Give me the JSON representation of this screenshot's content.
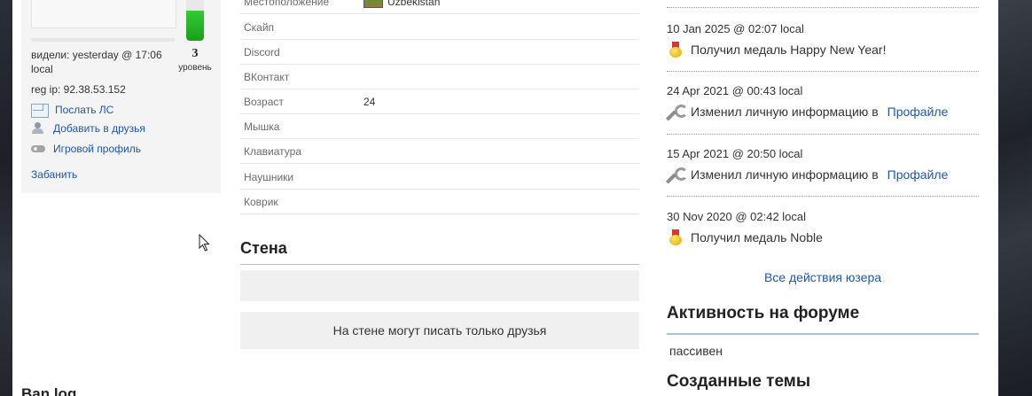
{
  "left": {
    "level_number": "3",
    "level_label": "уровень",
    "level_fill_percent": 75,
    "seen": "видели: yesterday @ 17:06 local",
    "reg_ip": "reg ip: 92.38.53.152",
    "links": [
      {
        "label": "Послать ЛС",
        "icon": "envelope-icon"
      },
      {
        "label": "Добавить в друзья",
        "icon": "add-friend-icon"
      },
      {
        "label": "Игровой профиль",
        "icon": "gamepad-icon"
      }
    ],
    "ban": "Забанить",
    "ban_log": "Ban log"
  },
  "info": {
    "rows": [
      {
        "label": "Местоположение",
        "value": "Uzbekistan"
      },
      {
        "label": "Скайп",
        "value": ""
      },
      {
        "label": "Discord",
        "value": ""
      },
      {
        "label": "ВКонтакт",
        "value": ""
      },
      {
        "label": "Возраст",
        "value": "24"
      },
      {
        "label": "Мышка",
        "value": ""
      },
      {
        "label": "Клавиатура",
        "value": ""
      },
      {
        "label": "Наушники",
        "value": ""
      },
      {
        "label": "Коврик",
        "value": ""
      }
    ]
  },
  "wall": {
    "title": "Стена",
    "notice": "На стене могут писать только друзья"
  },
  "activity": {
    "items": [
      {
        "date": "10 Jan 2025 @ 02:07 local",
        "text": "Получил медаль  Happy New Year!",
        "link": "",
        "icon": "medal-icon"
      },
      {
        "date": "24 Apr 2021 @ 00:43 local",
        "text": "Изменил личную информацию в",
        "link": "Профайле",
        "icon": "wrench-icon"
      },
      {
        "date": "15 Apr 2021 @ 20:50 local",
        "text": "Изменил личную информацию в",
        "link": "Профайле",
        "icon": "wrench-icon"
      },
      {
        "date": "30 Nov 2020 @ 02:42 local",
        "text": "Получил медаль  Noble",
        "link": "",
        "icon": "medal-icon"
      }
    ],
    "all_link": "Все действия юзера"
  },
  "forum": {
    "title": "Активность на форуме",
    "status": "пассивен",
    "topics_title": "Созданные темы"
  },
  "colors": {
    "link": "#2056a8",
    "level_bar": "#22aa22"
  }
}
